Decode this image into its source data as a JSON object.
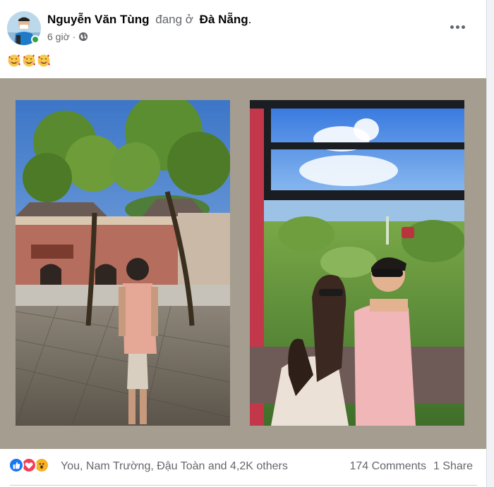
{
  "post": {
    "author": "Nguyễn Văn Tùng",
    "at_text": "đang ở",
    "location": "Đà Nẵng",
    "location_punct": ".",
    "time": "6 giờ",
    "time_separator": "·",
    "privacy_icon": "globe-icon",
    "more_icon": "more-options-icon",
    "caption_emojis": [
      "smiling-face-with-hearts-icon",
      "smiling-face-with-hearts-icon",
      "smiling-face-with-hearts-icon"
    ]
  },
  "photos": [
    {
      "subject": "man in pink polo walking toward temple gate under trees",
      "dominant_color": "#6a8fc4"
    },
    {
      "subject": "couple selfie in cable car over green forest",
      "dominant_color": "#5e8f3f"
    }
  ],
  "footer": {
    "reaction_icons": [
      "like-icon",
      "love-icon",
      "wow-icon"
    ],
    "reaction_names": "You, Nam Trường, Đậu Toàn and 4,2K others",
    "comments": "174 Comments",
    "shares": "1 Share"
  },
  "colors": {
    "like": "#1877f2",
    "love": "#f33e58",
    "wow": "#f7b125",
    "secondary_text": "#65676b",
    "photo_background": "#a59d8f"
  }
}
